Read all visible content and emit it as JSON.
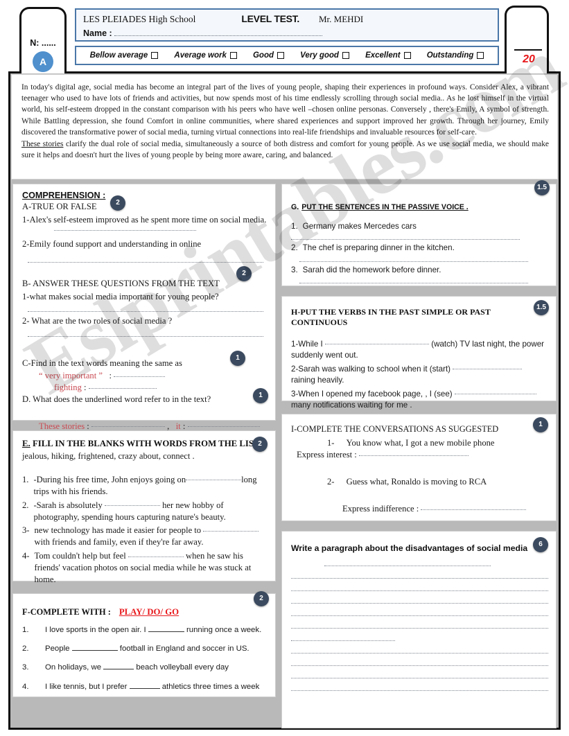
{
  "header": {
    "student_number_label": "N: ......",
    "group_badge": "A",
    "school_name": "LES PLEIADES High School",
    "test_title": "LEVEL TEST.",
    "teacher": "Mr. MEHDI",
    "name_label": "Name :",
    "grades": [
      "Bellow average",
      "Average work",
      "Good",
      "Very good",
      "Excellent",
      "Outstanding"
    ],
    "score_total": "20",
    "accent_blue": "#4a77a8",
    "badge_color": "#3b4a5f",
    "red": "#e8191c"
  },
  "watermark": "Eslprintables.com",
  "passage": {
    "para1": "In today's digital age, social media has become an integral part of the lives of young people, shaping their experiences in profound ways. Consider Alex, a vibrant teenager who used to have lots of friends and activities, but now spends most of his time endlessly scrolling through social media.. As he lost himself in the virtual world, his self-esteem dropped  in the constant comparison with his peers who have well –chosen online personas. Conversely , there's Emily, A symbol of strength. While Battling depression, she found Comfort in online communities, where shared experiences and support improved her growth. Through her journey, Emily discovered the transformative power of social media, turning virtual connections into real-life friendships and invaluable resources for self-care.",
    "para2_underlined": "These stories",
    "para2_rest": " clarify  the dual role of social media, simultaneously a source of both distress and comfort for young people. As we use social media, we should make sure  it helps and doesn't hurt the lives of young people by being more aware, caring, and balanced."
  },
  "comprehension": {
    "title": "COMPREHENSION :",
    "score_a": "2",
    "a_heading": "A-TRUE OR FALSE",
    "a_q1": "1-Alex's self-esteem improved as he spent more time on social media.",
    "a_q2": "2-Emily found support and understanding in online",
    "score_b": "2",
    "b_heading": "B- ANSWER THESE QUESTIONS FROM THE TEXT",
    "b_q1": "1-what makes social media important for young people?",
    "b_q2": "2- What are the two roles of social media ?",
    "score_c": "1",
    "c_heading": "C-Find in the text words meaning the same as",
    "c_word1": "“ very important ”",
    "c_word2": "fighting",
    "score_d": "1",
    "d_heading": "D. What does the underlined word refer to in the text?",
    "d_item1": "These stories",
    "d_item2": "it"
  },
  "section_e": {
    "score": "2",
    "letter": "E.",
    "heading": " FILL IN THE BLANKS WITH WORDS FROM THE LIST  :",
    "word_list": "jealous,  hiking,  frightened, crazy about, connect .",
    "items": [
      {
        "num": "1.",
        "before": "-During his free time, John enjoys going on",
        "after": "long  trips with his friends."
      },
      {
        "num": "2.",
        "before": "-Sarah is absolutely ",
        "after": " her new hobby of photography, spending hours capturing nature's beauty."
      },
      {
        "num": "3-",
        "before": "new technology has made it easier for people to ",
        "after": " with friends and family, even if they're far away."
      },
      {
        "num": "4-",
        "before": "Tom couldn't help but feel ",
        "after": " when he saw his friends' vacation photos on social media while he was stuck at home."
      }
    ]
  },
  "section_f": {
    "score": "2",
    "heading": "F-COMPLETE  WITH  :",
    "options": "PLAY/ DO/ GO",
    "items": [
      {
        "num": "1.",
        "before": "I love sports in the open air. I",
        "after": "running once a week.",
        "blank_w": 52
      },
      {
        "num": "2.",
        "before": "People",
        "after": "football in England and soccer in US.",
        "blank_w": 66
      },
      {
        "num": "3.",
        "before": "On holidays, we",
        "after": "beach volleyball every day",
        "blank_w": 44
      },
      {
        "num": "4.",
        "before": "I like tennis, but I prefer",
        "after": "athletics three times a week",
        "blank_w": 44
      }
    ]
  },
  "section_g": {
    "score": "1.5",
    "letter": "G.",
    "heading": "PUT THE SENTENCES IN THE PASSIVE VOICE .",
    "items": [
      {
        "num": "1.",
        "text": "Germany makes Mercedes cars"
      },
      {
        "num": "2.",
        "text": "The chef is preparing dinner in the kitchen."
      },
      {
        "num": "3.",
        "text": "Sarah did the homework before dinner."
      }
    ]
  },
  "section_h": {
    "score": "1.5",
    "heading": "H-PUT THE VERBS IN THE PAST SIMPLE OR  PAST CONTINUOUS",
    "q1_a": "1-While I",
    "q1_b": "(watch) TV last night, the power suddenly went out.",
    "q2_a": "2-Sarah was walking  to school when it (start)",
    "q2_b": "raining heavily.",
    "q3_a": "3-When I opened my facebook page, , I (see)",
    "q3_b": "many notifications waiting for me ."
  },
  "section_i": {
    "score": "1",
    "heading": "I-COMPLETE THE CONVERSATIONS AS SUGGESTED",
    "item1_num": "1-",
    "item1_text": "You know what, I got a new mobile phone",
    "item1_prompt": "Express interest :",
    "item2_num": "2-",
    "item2_text": "Guess what, Ronaldo is moving to RCA",
    "item2_prompt": "Express indifference :"
  },
  "writing": {
    "score": "6",
    "heading": "Write a paragraph about the disadvantages of social media"
  }
}
